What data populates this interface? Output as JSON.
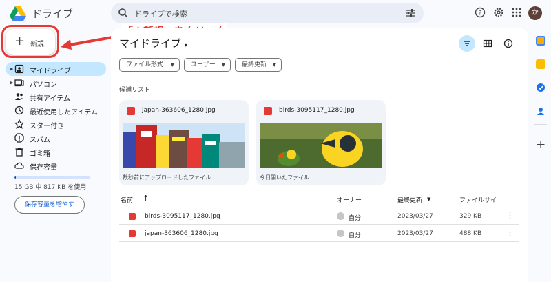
{
  "app": {
    "title": "ドライブ"
  },
  "search": {
    "placeholder": "ドライブで検索"
  },
  "new_button": {
    "label": "新規"
  },
  "annotation": {
    "text": "「＋新規」をクリック"
  },
  "sidebar": {
    "items": [
      {
        "label": "マイドライブ",
        "icon": "my-drive-icon"
      },
      {
        "label": "パソコン",
        "icon": "computer-icon"
      },
      {
        "label": "共有アイテム",
        "icon": "shared-icon"
      },
      {
        "label": "最近使用したアイテム",
        "icon": "clock-icon"
      },
      {
        "label": "スター付き",
        "icon": "star-icon"
      },
      {
        "label": "スパム",
        "icon": "spam-icon"
      },
      {
        "label": "ゴミ箱",
        "icon": "trash-icon"
      },
      {
        "label": "保存容量",
        "icon": "cloud-icon"
      }
    ],
    "storage_text": "15 GB 中 817 KB を使用",
    "storage_fraction": 0.01,
    "storage_button": "保存容量を増やす"
  },
  "main": {
    "title": "マイドライブ",
    "filters": [
      "ファイル形式",
      "ユーザー",
      "最終更新"
    ],
    "suggested_label": "候補リスト",
    "cards": [
      {
        "name": "japan-363606_1280.jpg",
        "subtitle": "数秒前にアップロードしたファイル"
      },
      {
        "name": "birds-3095117_1280.jpg",
        "subtitle": "今日開いたファイル"
      }
    ],
    "table": {
      "headers": {
        "name": "名前",
        "owner": "オーナー",
        "modified": "最終更新",
        "size": "ファイルサイ"
      },
      "rows": [
        {
          "name": "birds-3095117_1280.jpg",
          "owner": "自分",
          "date": "2023/03/27",
          "size": "329 KB"
        },
        {
          "name": "japan-363606_1280.jpg",
          "owner": "自分",
          "date": "2023/03/27",
          "size": "488 KB"
        }
      ]
    }
  },
  "user": {
    "avatar_initial": "か"
  },
  "colors": {
    "accent": "#0b57d0",
    "active_bg": "#c2e7ff",
    "highlight": "#e53935"
  }
}
